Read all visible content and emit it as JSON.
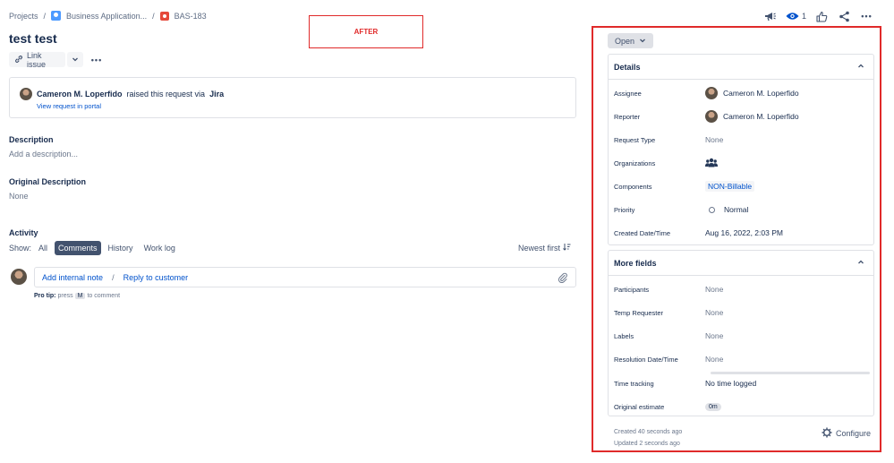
{
  "breadcrumb": {
    "projects": "Projects",
    "separator": "/",
    "project": "Business Application...",
    "issue_key": "BAS-183"
  },
  "issue": {
    "title": "test test"
  },
  "annotation": {
    "label": "AFTER",
    "color": "#e02a2a"
  },
  "toolbar": {
    "link_issue": "Link issue",
    "more": "•••"
  },
  "request": {
    "raiser": "Cameron M. Loperfido",
    "raised_text": "raised this request via",
    "channel": "Jira",
    "view_link": "View request in portal"
  },
  "description": {
    "label": "Description",
    "placeholder": "Add a description..."
  },
  "original_description": {
    "label": "Original Description",
    "value": "None"
  },
  "activity": {
    "label": "Activity",
    "show_label": "Show:",
    "filters": [
      "All",
      "Comments",
      "History",
      "Work log"
    ],
    "active_filter": "Comments",
    "sort": "Newest first",
    "add_internal_note": "Add internal note",
    "separator": "/",
    "reply_to_customer": "Reply to customer",
    "protip_label": "Pro tip:",
    "protip_press": "press",
    "protip_key": "M",
    "protip_rest": "to comment"
  },
  "top_actions": {
    "watch_count": "1",
    "more": "•••"
  },
  "status": {
    "label": "Open"
  },
  "details": {
    "title": "Details",
    "rows": [
      {
        "label": "Assignee",
        "value": "Cameron M. Loperfido"
      },
      {
        "label": "Reporter",
        "value": "Cameron M. Loperfido"
      },
      {
        "label": "Request Type",
        "value": "None"
      },
      {
        "label": "Organizations",
        "value": ""
      },
      {
        "label": "Components",
        "value": "NON-Billable"
      },
      {
        "label": "Priority",
        "value": "Normal"
      },
      {
        "label": "Created Date/Time",
        "value": "Aug 16, 2022, 2:03 PM"
      }
    ]
  },
  "more_fields": {
    "title": "More fields",
    "rows": [
      {
        "label": "Participants",
        "value": "None"
      },
      {
        "label": "Temp Requester",
        "value": "None"
      },
      {
        "label": "Labels",
        "value": "None"
      },
      {
        "label": "Resolution Date/Time",
        "value": "None"
      },
      {
        "label": "Time tracking",
        "value": "No time logged"
      },
      {
        "label": "Original estimate",
        "value": "0m"
      }
    ]
  },
  "footer": {
    "created": "Created 40 seconds ago",
    "updated": "Updated 2 seconds ago",
    "configure": "Configure"
  }
}
